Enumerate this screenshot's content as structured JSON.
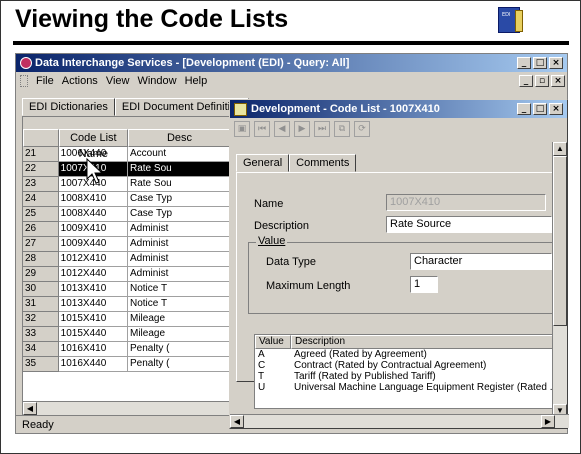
{
  "slide": {
    "title": "Viewing the Code Lists",
    "icon_label": "EDI"
  },
  "main_window": {
    "title": "Data Interchange Services - [Development (EDI) - Query: All]",
    "menu": [
      "File",
      "Actions",
      "View",
      "Window",
      "Help"
    ],
    "tabs": [
      "EDI Dictionaries",
      "EDI Document Definition"
    ],
    "grid": {
      "columns": [
        "",
        "Code List Name",
        "Desc"
      ],
      "rows": [
        {
          "num": "21",
          "name": "1006X440",
          "desc": "Account"
        },
        {
          "num": "22",
          "name": "1007X410",
          "desc": "Rate Sou"
        },
        {
          "num": "23",
          "name": "1007X440",
          "desc": "Rate Sou"
        },
        {
          "num": "24",
          "name": "1008X410",
          "desc": "Case Typ"
        },
        {
          "num": "25",
          "name": "1008X440",
          "desc": "Case Typ"
        },
        {
          "num": "26",
          "name": "1009X410",
          "desc": "Administ"
        },
        {
          "num": "27",
          "name": "1009X440",
          "desc": "Administ"
        },
        {
          "num": "28",
          "name": "1012X410",
          "desc": "Administ"
        },
        {
          "num": "29",
          "name": "1012X440",
          "desc": "Administ"
        },
        {
          "num": "30",
          "name": "1013X410",
          "desc": "Notice T"
        },
        {
          "num": "31",
          "name": "1013X440",
          "desc": "Notice T"
        },
        {
          "num": "32",
          "name": "1015X410",
          "desc": "Mileage"
        },
        {
          "num": "33",
          "name": "1015X440",
          "desc": "Mileage"
        },
        {
          "num": "34",
          "name": "1016X410",
          "desc": "Penalty ("
        },
        {
          "num": "35",
          "name": "1016X440",
          "desc": "Penalty ("
        }
      ],
      "selected_row": "22"
    },
    "status": "Ready"
  },
  "dialog": {
    "title": "Development - Code List - 1007X410",
    "tabs": [
      "General",
      "Comments"
    ],
    "name_label": "Name",
    "name_value": "1007X410",
    "description_label": "Description",
    "description_value": "Rate Source",
    "value_group_label": "Value",
    "data_type_label": "Data Type",
    "data_type_value": "Character",
    "max_length_label": "Maximum Length",
    "max_length_value": "1",
    "values_table": {
      "columns": [
        "Value",
        "Description"
      ],
      "rows": [
        {
          "value": "A",
          "description": "Agreed (Rated by Agreement)"
        },
        {
          "value": "C",
          "description": "Contract (Rated by Contractual Agreement)"
        },
        {
          "value": "T",
          "description": "Tariff (Rated by Published Tariff)"
        },
        {
          "value": "U",
          "description": "Universal Machine Language Equipment Register (Rated ..."
        }
      ]
    }
  },
  "colors": {
    "titlebar_start": "#0a246a",
    "titlebar_end": "#a6caf0",
    "window_bg": "#d4d0c8",
    "selection": "#000000"
  }
}
